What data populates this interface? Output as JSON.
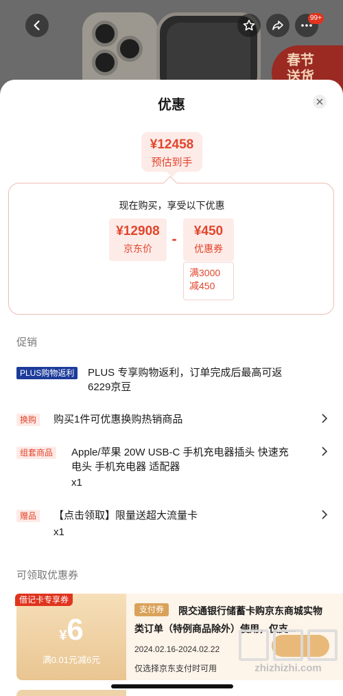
{
  "topbar": {
    "cart_badge": "99+",
    "promo_banner": "春节送货"
  },
  "sheet": {
    "title": "优惠"
  },
  "estimate": {
    "price": "¥12458",
    "label": "预估到手"
  },
  "calc": {
    "heading": "现在购买，享受以下优惠",
    "jd_price": {
      "amount": "¥12908",
      "label": "京东价"
    },
    "operator": "-",
    "coupon": {
      "amount": "¥450",
      "label": "优惠券",
      "condition_line1": "满3000",
      "condition_line2": "减450"
    }
  },
  "promotions": {
    "title": "促销",
    "items": [
      {
        "tag": "PLUS购物返利",
        "text_line1": "PLUS 专享购物返利，订单完成后最高可返",
        "text_line2": "6229京豆",
        "qty": ""
      },
      {
        "tag": "换购",
        "text_line1": "购买1件可优惠换购热销商品",
        "text_line2": "",
        "qty": ""
      },
      {
        "tag": "组套商品",
        "text_line1": "Apple/苹果 20W USB-C 手机充电器插头 快速充",
        "text_line2": "电头 手机充电器 适配器",
        "qty": "x1"
      },
      {
        "tag": "赠品",
        "text_line1": "【点击领取】限量送超大流量卡",
        "text_line2": "",
        "qty": "x1"
      }
    ]
  },
  "coupons": {
    "title": "可领取优惠券",
    "card": {
      "flag": "借记卡专享券",
      "currency": "¥",
      "value": "6",
      "condition": "满0.01元减6元",
      "pay_tag": "支付券",
      "description": "限交通银行储蓄卡购京东商城实物类订单（特例商品除外）使用，仅支...",
      "date_range": "2024.02.16-2024.02.22",
      "note": "仅选择京东支付时可用"
    }
  },
  "watermark": {
    "text": "zhizhizhi.com"
  },
  "colors": {
    "accent": "#e2452c",
    "accent_bg": "#fdebe8",
    "plus_tag": "#1c3b9a",
    "coupon_gold": "#e9c591"
  }
}
